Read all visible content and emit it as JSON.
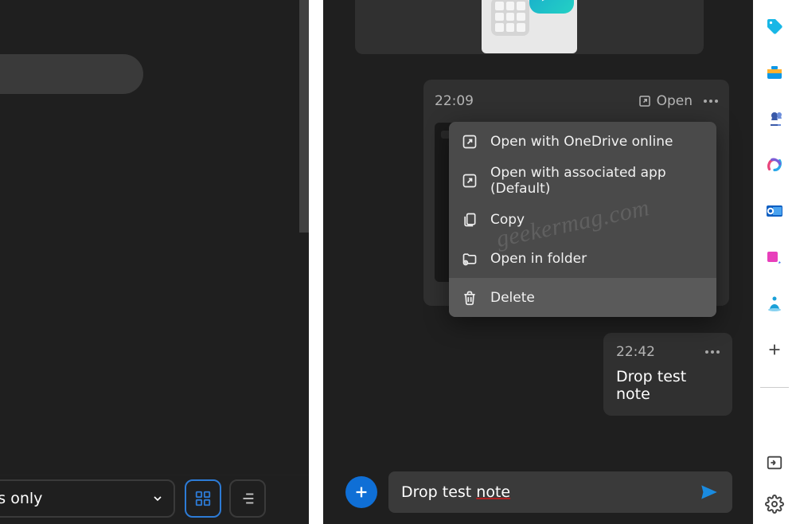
{
  "left": {
    "filter_label": "is only",
    "icons": {
      "grid": "grid-view-icon",
      "list": "list-view-icon",
      "chevron": "chevron-down-icon"
    }
  },
  "main": {
    "file_card": {
      "time": "22:09",
      "open_label": "Open"
    },
    "context_menu": {
      "items": [
        {
          "label": "Open with OneDrive online",
          "icon": "external-link-icon"
        },
        {
          "label": "Open with associated app (Default)",
          "icon": "external-link-icon"
        },
        {
          "label": "Copy",
          "icon": "copy-icon"
        },
        {
          "label": "Open in folder",
          "icon": "folder-open-icon"
        },
        {
          "label": "Delete",
          "icon": "trash-icon"
        }
      ]
    },
    "note_card": {
      "time": "22:42",
      "text": "Drop test note"
    },
    "compose": {
      "value_plain": "Drop test ",
      "value_underlined": "note"
    },
    "watermark": "geekermag.com"
  },
  "sidebar": {
    "items": [
      {
        "name": "tag-icon",
        "color": "#1aa0d8"
      },
      {
        "name": "toolbox-icon",
        "color": "#0c9aeb"
      },
      {
        "name": "chess-icon",
        "color": "#3355a4"
      },
      {
        "name": "copilot-icon",
        "color": "multi"
      },
      {
        "name": "outlook-icon",
        "color": "#0f5fc2"
      },
      {
        "name": "clip-icon",
        "color": "#e83fbb"
      },
      {
        "name": "meditation-icon",
        "color": "#1aa0d8"
      }
    ],
    "plus": "plus-icon",
    "bottom": [
      {
        "name": "panel-icon"
      },
      {
        "name": "settings-icon"
      }
    ]
  }
}
